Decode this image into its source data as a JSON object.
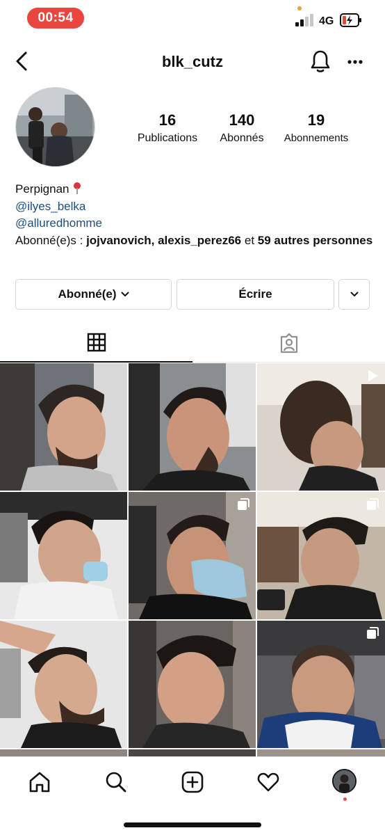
{
  "status_bar": {
    "time": "00:54",
    "network": "4G",
    "time_pill_color": "#e8463e",
    "signal_bars_active": 2,
    "signal_bars_total": 4,
    "battery_state": "charging, low"
  },
  "header": {
    "username": "blk_cutz",
    "icons": [
      "back-icon",
      "bell-icon",
      "more-icon"
    ]
  },
  "stats": {
    "posts_count": "16",
    "posts_label": "Publications",
    "followers_count": "140",
    "followers_label": "Abonnés",
    "following_count": "19",
    "following_label": "Abonnements"
  },
  "bio": {
    "location": "Perpignan",
    "location_icon": "pin-icon",
    "link1": "@ilyes_belka",
    "link2": "@alluredhomme",
    "followed_by_prefix": "Abonné(e)s :",
    "followed_by_user1": "jojvanovich",
    "followed_by_sep": ",",
    "followed_by_user2": "alexis_perez66",
    "followed_by_mid": "et",
    "followed_by_others": "59 autres",
    "followed_by_others_end": "personnes",
    "link_color": "#1e4d7b"
  },
  "actions": {
    "following_label": "Abonné(e)",
    "message_label": "Écrire"
  },
  "tabs": {
    "active": "grid",
    "items": [
      "grid-icon",
      "tagged-icon"
    ]
  },
  "grid": {
    "posts": [
      {
        "badge": "none"
      },
      {
        "badge": "none"
      },
      {
        "badge": "video"
      },
      {
        "badge": "none"
      },
      {
        "badge": "carousel"
      },
      {
        "badge": "carousel"
      },
      {
        "badge": "none"
      },
      {
        "badge": "none"
      },
      {
        "badge": "carousel"
      }
    ]
  },
  "bottom_nav": {
    "items": [
      "home-icon",
      "search-icon",
      "create-icon",
      "activity-icon",
      "profile-avatar"
    ],
    "notification_dot_color": "#ed4956"
  }
}
